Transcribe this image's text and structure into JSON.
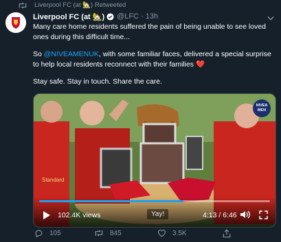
{
  "retweet_banner": {
    "text": "Liverpool FC (at 🏡) Retweeted"
  },
  "tweet": {
    "author_name": "Liverpool FC (at 🏡)",
    "handle": "@LFC",
    "separator": "·",
    "time": "13h",
    "paragraph_1": "Many care home residents suffered the pain of being unable to see loved ones during this difficult time...",
    "paragraph_2_before": "So ",
    "mention": "@NIVEAMENUK",
    "paragraph_2_after": ", with some familiar faces, delivered a special surprise to help local residents reconnect with their families ",
    "heart": "❤️",
    "paragraph_3": "Stay safe. Stay in touch. Share the care."
  },
  "video": {
    "views": "102.4K views",
    "caption": "Yay!",
    "timecode": "4:13 / 6:46",
    "progress_fraction": 0.624,
    "badge_line_1": "NIVEA",
    "badge_line_2": "MEN"
  },
  "actions": {
    "reply_count": "105",
    "retweet_count": "845",
    "like_count": "3.5K"
  },
  "colors": {
    "background": "#15202b",
    "secondary_text": "#8899a6",
    "accent": "#1da1f2",
    "heart": "#e0245e"
  },
  "icons": [
    "retweet-icon",
    "verified-icon",
    "chevron-down-icon",
    "play-icon",
    "volume-icon",
    "fullscreen-icon",
    "reply-icon",
    "like-icon",
    "share-icon"
  ]
}
